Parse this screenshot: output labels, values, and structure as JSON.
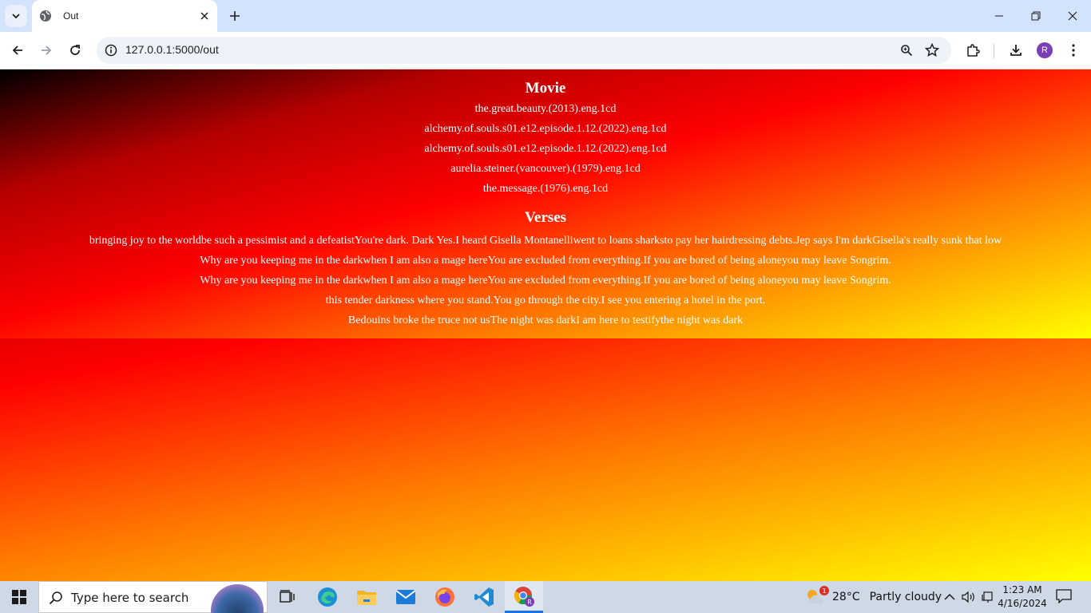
{
  "browser": {
    "tab_title": "Out",
    "url": "127.0.0.1:5000/out",
    "profile_initial": "R"
  },
  "page": {
    "movie_heading": "Movie",
    "movies": [
      "the.great.beauty.(2013).eng.1cd",
      "alchemy.of.souls.s01.e12.episode.1.12.(2022).eng.1cd",
      "alchemy.of.souls.s01.e12.episode.1.12.(2022).eng.1cd",
      "aurelia.steiner.(vancouver).(1979).eng.1cd",
      "the.message.(1976).eng.1cd"
    ],
    "verses_heading": "Verses",
    "verses": [
      "bringing joy to the worldbe such a pessimist and a defeatistYou're dark. Dark Yes.I heard Gisella Montanelliwent to loans sharksto pay her hairdressing debts.Jep says I'm darkGisella's really sunk that low",
      "Why are you keeping me in the darkwhen I am also a mage hereYou are excluded from everything.If you are bored of being aloneyou may leave Songrim.",
      "Why are you keeping me in the darkwhen I am also a mage hereYou are excluded from everything.If you are bored of being aloneyou may leave Songrim.",
      "this tender darkness where you stand.You go through the city.I see you entering a hotel in the port.",
      "Bedouins broke the truce not usThe night was darkI am here to testifythe night was dark"
    ]
  },
  "taskbar": {
    "search_placeholder": "Type here to search",
    "weather_temp": "28°C",
    "weather_desc": "Partly cloudy",
    "weather_badge": "1",
    "time": "1:23 AM",
    "date": "4/16/2024",
    "chrome_profile_initial": "R"
  }
}
